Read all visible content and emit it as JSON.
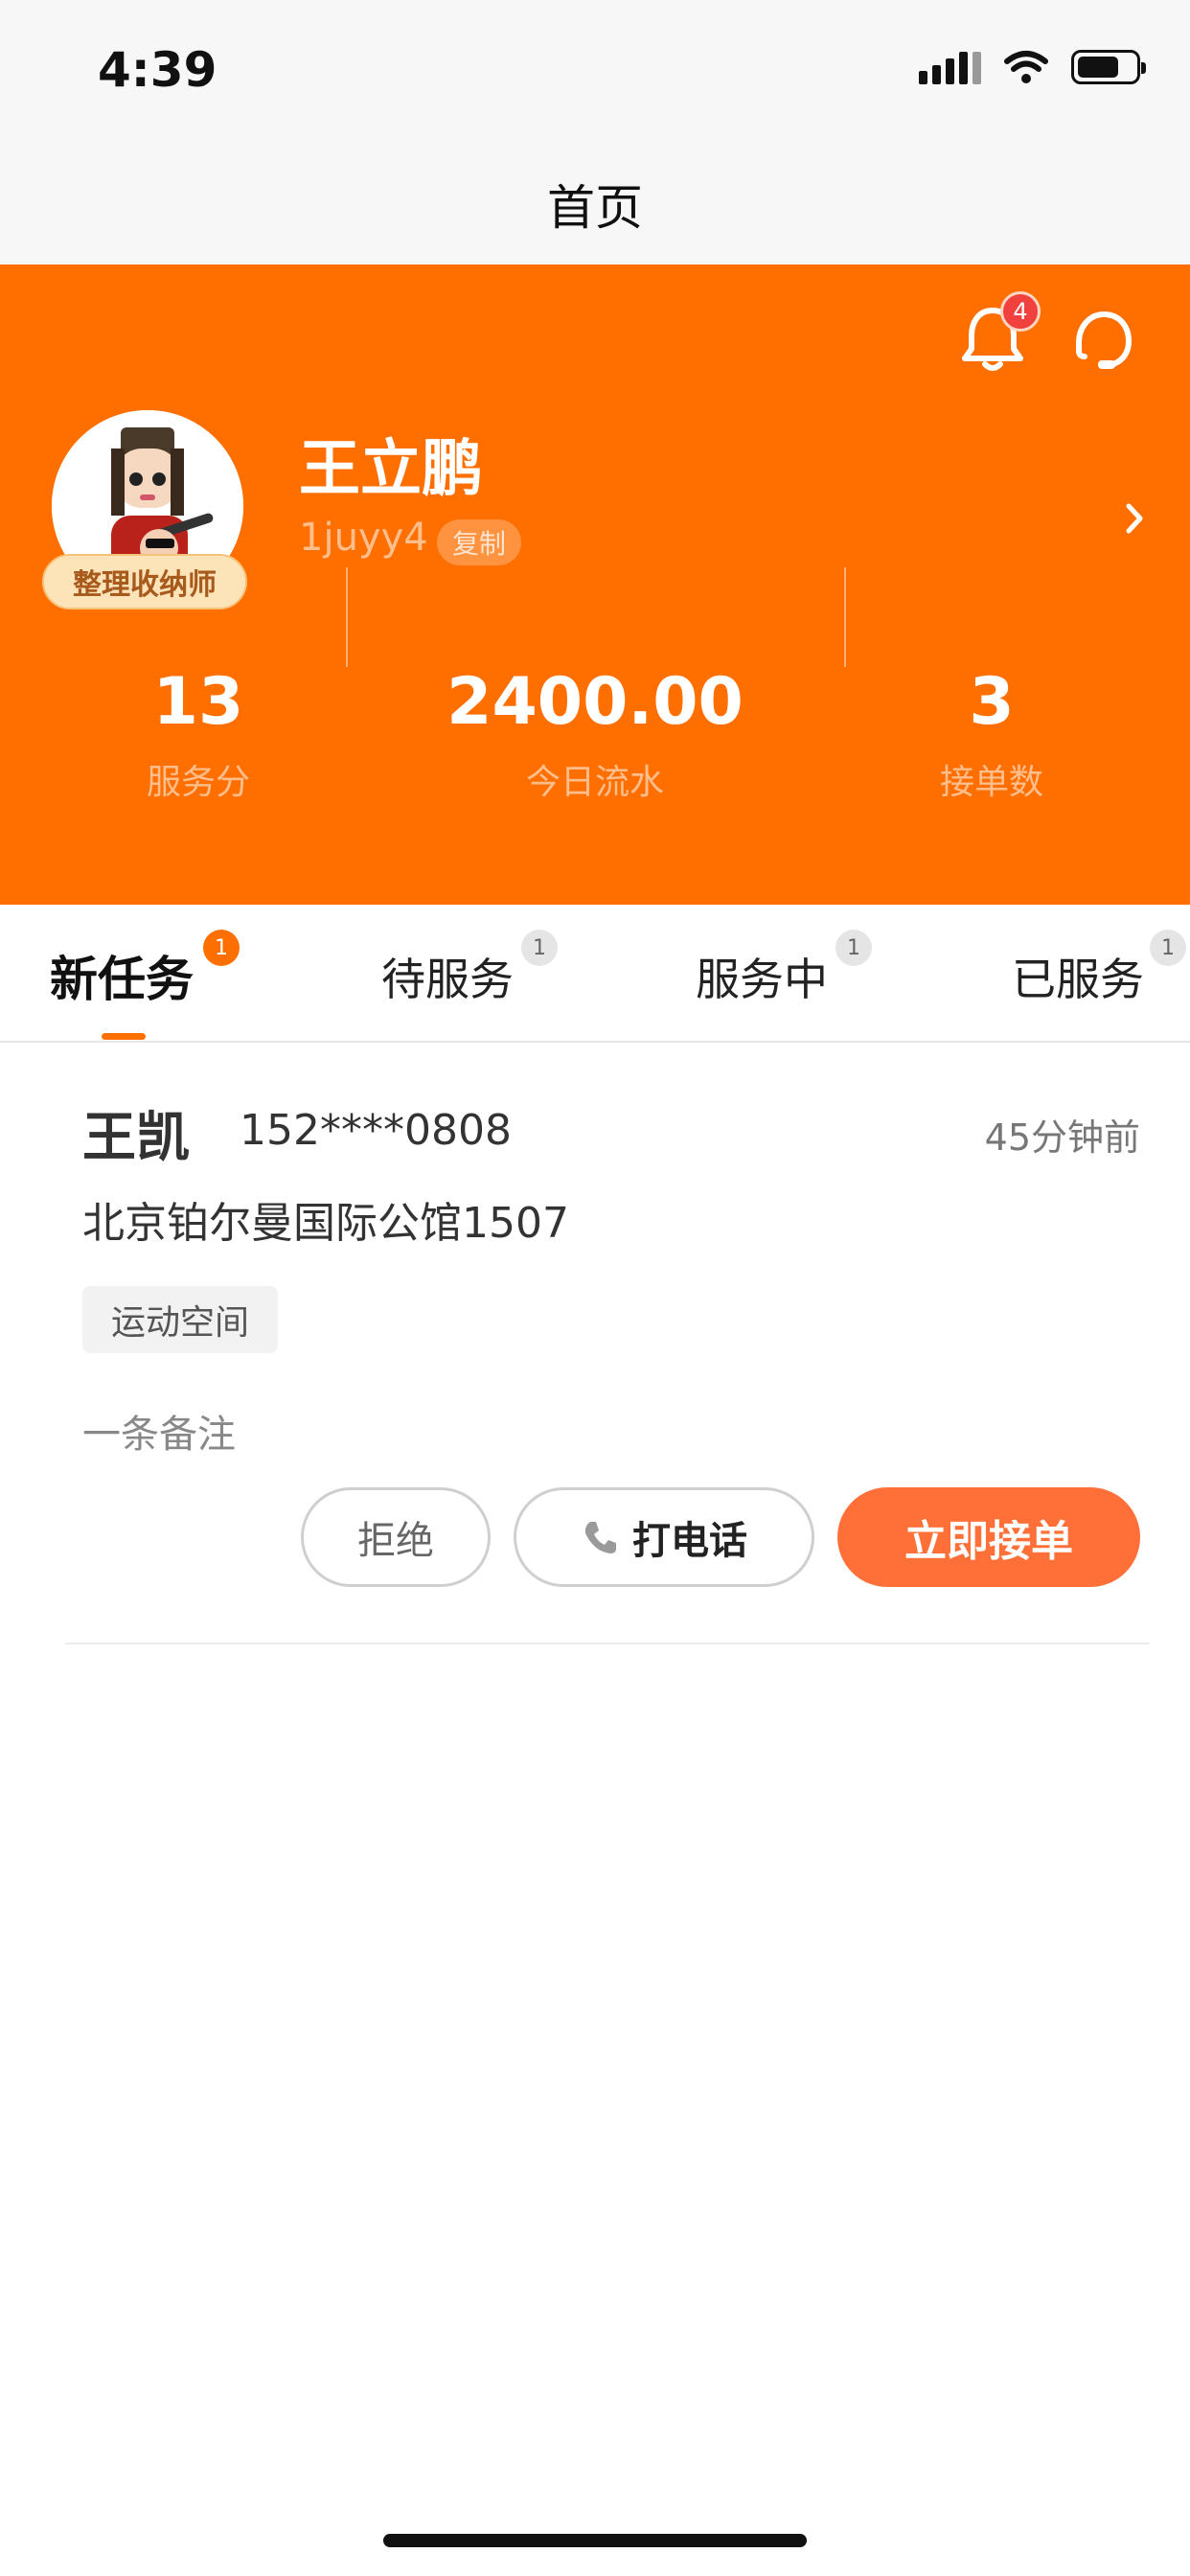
{
  "status_bar": {
    "time": "4:39"
  },
  "nav": {
    "title": "首页"
  },
  "header": {
    "notification_count": "4",
    "user_name": "王立鹏",
    "user_id": "1juyy4",
    "copy_label": "复制",
    "role_badge": "整理收纳师",
    "icons": [
      "bell-icon",
      "customer-service-icon",
      "chevron-right-icon"
    ],
    "brand_color": "#ff6f00"
  },
  "stats": [
    {
      "value": "13",
      "label": "服务分"
    },
    {
      "value": "2400.00",
      "label": "今日流水"
    },
    {
      "value": "3",
      "label": "接单数"
    }
  ],
  "tabs": [
    {
      "label": "新任务",
      "count": "1",
      "active": true
    },
    {
      "label": "待服务",
      "count": "1",
      "active": false
    },
    {
      "label": "服务中",
      "count": "1",
      "active": false
    },
    {
      "label": "已服务",
      "count": "1",
      "active": false
    }
  ],
  "order": {
    "customer_name": "王凯",
    "phone": "152****0808",
    "time_ago": "45分钟前",
    "address": "北京铂尔曼国际公馆1507",
    "tag": "运动空间",
    "note": "一条备注",
    "reject_label": "拒绝",
    "call_label": "打电话",
    "accept_label": "立即接单",
    "accept_color": "#ff7038"
  }
}
